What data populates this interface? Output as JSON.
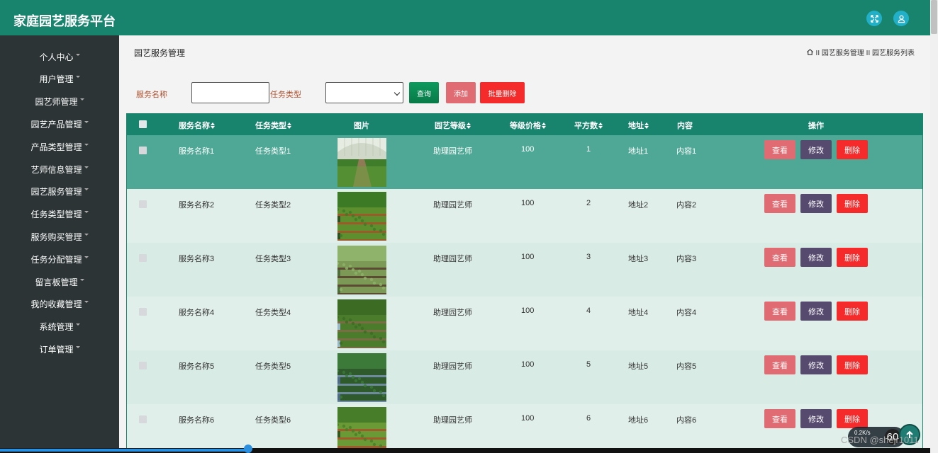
{
  "app": {
    "title": "家庭园艺服务平台"
  },
  "sidebar": {
    "items": [
      {
        "label": "个人中心"
      },
      {
        "label": "用户管理"
      },
      {
        "label": "园艺师管理"
      },
      {
        "label": "园艺产品管理"
      },
      {
        "label": "产品类型管理"
      },
      {
        "label": "艺师信息管理"
      },
      {
        "label": "园艺服务管理"
      },
      {
        "label": "任务类型管理"
      },
      {
        "label": "服务购买管理"
      },
      {
        "label": "任务分配管理"
      },
      {
        "label": "留言板管理"
      },
      {
        "label": "我的收藏管理"
      },
      {
        "label": "系统管理"
      },
      {
        "label": "订单管理"
      }
    ]
  },
  "page": {
    "heading": "园艺服务管理",
    "breadcrumb": "II 园艺服务管理 II 园艺服务列表"
  },
  "search": {
    "name_label": "服务名称",
    "name_value": "",
    "type_label": "任务类型",
    "type_value": "",
    "query_label": "查询",
    "add_label": "添加",
    "batch_delete_label": "批量删除"
  },
  "table": {
    "headers": {
      "name": "服务名称",
      "type": "任务类型",
      "image": "图片",
      "level": "园艺等级",
      "price": "等级价格",
      "area": "平方数",
      "address": "地址",
      "content": "内容",
      "actions": "操作"
    },
    "rows": [
      {
        "name": "服务名称1",
        "type": "任务类型1",
        "level": "助理园艺师",
        "price": "100",
        "area": "1",
        "address": "地址1",
        "content": "内容1"
      },
      {
        "name": "服务名称2",
        "type": "任务类型2",
        "level": "助理园艺师",
        "price": "100",
        "area": "2",
        "address": "地址2",
        "content": "内容2"
      },
      {
        "name": "服务名称3",
        "type": "任务类型3",
        "level": "助理园艺师",
        "price": "100",
        "area": "3",
        "address": "地址3",
        "content": "内容3"
      },
      {
        "name": "服务名称4",
        "type": "任务类型4",
        "level": "助理园艺师",
        "price": "100",
        "area": "4",
        "address": "地址4",
        "content": "内容4"
      },
      {
        "name": "服务名称5",
        "type": "任务类型5",
        "level": "助理园艺师",
        "price": "100",
        "area": "5",
        "address": "地址5",
        "content": "内容5"
      },
      {
        "name": "服务名称6",
        "type": "任务类型6",
        "level": "助理园艺师",
        "price": "100",
        "area": "6",
        "address": "地址6",
        "content": "内容6"
      }
    ],
    "view_label": "查看",
    "edit_label": "修改",
    "delete_label": "删除"
  },
  "overlay": {
    "net_rate": "0.2K/s",
    "net_count": "60",
    "watermark": "CSDN @shejr1011",
    "progress": 0.267
  },
  "colors": {
    "topbar": "#18846e",
    "sidebar": "#2c3436",
    "view": "#e16b72",
    "edit": "#574a6f",
    "delete": "#f52b2b",
    "query": "#0b8b55"
  }
}
